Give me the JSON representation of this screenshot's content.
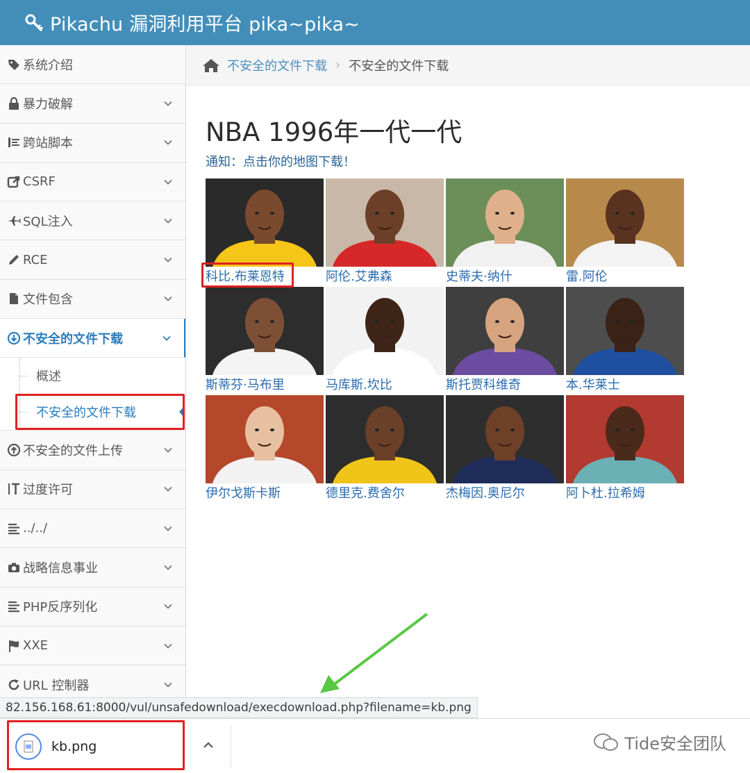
{
  "header": {
    "title": "Pikachu 漏洞利用平台 pika~pika~"
  },
  "sidebar": {
    "items": [
      {
        "label": "系统介绍",
        "icon": "tags-icon",
        "chevron": false
      },
      {
        "label": "暴力破解",
        "icon": "lock-icon",
        "chevron": true
      },
      {
        "label": "跨站脚本",
        "icon": "list-icon",
        "chevron": true
      },
      {
        "label": "CSRF",
        "icon": "share-icon",
        "chevron": true
      },
      {
        "label": "SQL注入",
        "icon": "plane-icon",
        "chevron": true
      },
      {
        "label": "RCE",
        "icon": "pencil-icon",
        "chevron": true
      },
      {
        "label": "文件包含",
        "icon": "file-icon",
        "chevron": true
      },
      {
        "label": "不安全的文件下载",
        "icon": "download-circle-icon",
        "chevron": true,
        "active": true
      },
      {
        "label": "不安全的文件上传",
        "icon": "upload-circle-icon",
        "chevron": true
      },
      {
        "label": "过度许可",
        "icon": "text-height-icon",
        "chevron": true
      },
      {
        "label": "../../",
        "icon": "align-left-icon",
        "chevron": true
      },
      {
        "label": "战略信息事业",
        "icon": "camera-icon",
        "chevron": true
      },
      {
        "label": "PHP反序列化",
        "icon": "align-left-icon",
        "chevron": true
      },
      {
        "label": "XXE",
        "icon": "flag-icon",
        "chevron": true
      },
      {
        "label": "URL 控制器",
        "icon": "refresh-icon",
        "chevron": true
      }
    ],
    "submenu": [
      {
        "label": "概述"
      },
      {
        "label": "不安全的文件下载",
        "active": true
      }
    ]
  },
  "breadcrumb": {
    "link": "不安全的文件下载",
    "current": "不安全的文件下载"
  },
  "main": {
    "title": "NBA 1996年一代一代",
    "notice": "通知：点击你的地图下载！",
    "players": [
      {
        "name": "科比.布莱恩特",
        "jersey": "#f5c518",
        "bg": "#2a2a2a",
        "skin": "#7a4a2e"
      },
      {
        "name": "阿伦.艾弗森",
        "jersey": "#d62828",
        "bg": "#c9b8a8",
        "skin": "#6b3f28"
      },
      {
        "name": "史蒂夫·纳什",
        "jersey": "#f1f1f1",
        "bg": "#6c8f5a",
        "skin": "#e0b08c"
      },
      {
        "name": "雷.阿伦",
        "jersey": "#f3f3f3",
        "bg": "#b78a4c",
        "skin": "#5a3220"
      },
      {
        "name": "斯蒂芬·马布里",
        "jersey": "#f4f4f4",
        "bg": "#2d2d2d",
        "skin": "#7d5036"
      },
      {
        "name": "马库斯.坎比",
        "jersey": "#ffffff",
        "bg": "#f2f2f2",
        "skin": "#3f2418"
      },
      {
        "name": "斯托贾科维奇",
        "jersey": "#6b4ca0",
        "bg": "#3f3f3f",
        "skin": "#d8a37f"
      },
      {
        "name": "本.华莱士",
        "jersey": "#1f4fa0",
        "bg": "#4d4d4d",
        "skin": "#3b2216"
      },
      {
        "name": "伊尔戈斯卡斯",
        "jersey": "#f2f2f2",
        "bg": "#b5472a",
        "skin": "#e6c0a0"
      },
      {
        "name": "德里克.费舍尔",
        "jersey": "#f0c419",
        "bg": "#2d2d2d",
        "skin": "#6b4029"
      },
      {
        "name": "杰梅因.奥尼尔",
        "jersey": "#1e2c5a",
        "bg": "#2e2e2e",
        "skin": "#6e4028"
      },
      {
        "name": "阿卜杜.拉希姆",
        "jersey": "#6bb0b5",
        "bg": "#b23a30",
        "skin": "#4a2a1a"
      }
    ]
  },
  "status_url": "82.156.168.61:8000/vul/unsafedownload/execdownload.php?filename=kb.png",
  "download": {
    "filename": "kb.png"
  },
  "watermark": "Tide安全团队"
}
